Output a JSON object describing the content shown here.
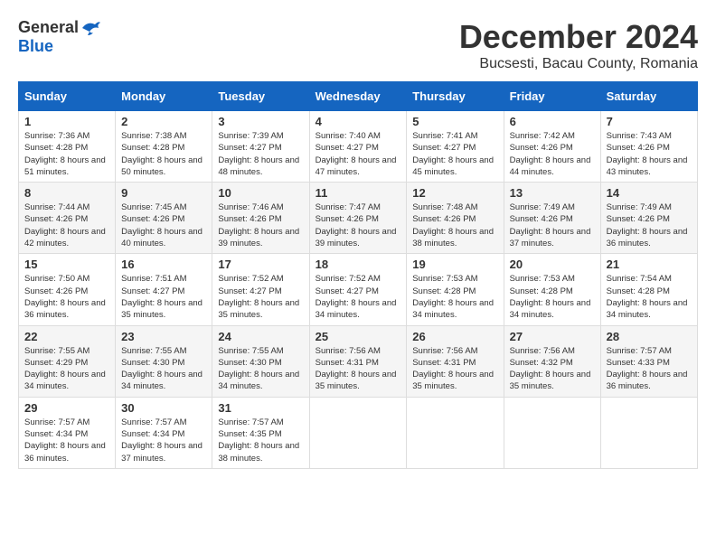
{
  "logo": {
    "general": "General",
    "blue": "Blue"
  },
  "title": {
    "month": "December 2024",
    "location": "Bucsesti, Bacau County, Romania"
  },
  "headers": [
    "Sunday",
    "Monday",
    "Tuesday",
    "Wednesday",
    "Thursday",
    "Friday",
    "Saturday"
  ],
  "weeks": [
    [
      {
        "day": "1",
        "sunrise": "7:36 AM",
        "sunset": "4:28 PM",
        "daylight": "8 hours and 51 minutes."
      },
      {
        "day": "2",
        "sunrise": "7:38 AM",
        "sunset": "4:28 PM",
        "daylight": "8 hours and 50 minutes."
      },
      {
        "day": "3",
        "sunrise": "7:39 AM",
        "sunset": "4:27 PM",
        "daylight": "8 hours and 48 minutes."
      },
      {
        "day": "4",
        "sunrise": "7:40 AM",
        "sunset": "4:27 PM",
        "daylight": "8 hours and 47 minutes."
      },
      {
        "day": "5",
        "sunrise": "7:41 AM",
        "sunset": "4:27 PM",
        "daylight": "8 hours and 45 minutes."
      },
      {
        "day": "6",
        "sunrise": "7:42 AM",
        "sunset": "4:26 PM",
        "daylight": "8 hours and 44 minutes."
      },
      {
        "day": "7",
        "sunrise": "7:43 AM",
        "sunset": "4:26 PM",
        "daylight": "8 hours and 43 minutes."
      }
    ],
    [
      {
        "day": "8",
        "sunrise": "7:44 AM",
        "sunset": "4:26 PM",
        "daylight": "8 hours and 42 minutes."
      },
      {
        "day": "9",
        "sunrise": "7:45 AM",
        "sunset": "4:26 PM",
        "daylight": "8 hours and 40 minutes."
      },
      {
        "day": "10",
        "sunrise": "7:46 AM",
        "sunset": "4:26 PM",
        "daylight": "8 hours and 39 minutes."
      },
      {
        "day": "11",
        "sunrise": "7:47 AM",
        "sunset": "4:26 PM",
        "daylight": "8 hours and 39 minutes."
      },
      {
        "day": "12",
        "sunrise": "7:48 AM",
        "sunset": "4:26 PM",
        "daylight": "8 hours and 38 minutes."
      },
      {
        "day": "13",
        "sunrise": "7:49 AM",
        "sunset": "4:26 PM",
        "daylight": "8 hours and 37 minutes."
      },
      {
        "day": "14",
        "sunrise": "7:49 AM",
        "sunset": "4:26 PM",
        "daylight": "8 hours and 36 minutes."
      }
    ],
    [
      {
        "day": "15",
        "sunrise": "7:50 AM",
        "sunset": "4:26 PM",
        "daylight": "8 hours and 36 minutes."
      },
      {
        "day": "16",
        "sunrise": "7:51 AM",
        "sunset": "4:27 PM",
        "daylight": "8 hours and 35 minutes."
      },
      {
        "day": "17",
        "sunrise": "7:52 AM",
        "sunset": "4:27 PM",
        "daylight": "8 hours and 35 minutes."
      },
      {
        "day": "18",
        "sunrise": "7:52 AM",
        "sunset": "4:27 PM",
        "daylight": "8 hours and 34 minutes."
      },
      {
        "day": "19",
        "sunrise": "7:53 AM",
        "sunset": "4:28 PM",
        "daylight": "8 hours and 34 minutes."
      },
      {
        "day": "20",
        "sunrise": "7:53 AM",
        "sunset": "4:28 PM",
        "daylight": "8 hours and 34 minutes."
      },
      {
        "day": "21",
        "sunrise": "7:54 AM",
        "sunset": "4:28 PM",
        "daylight": "8 hours and 34 minutes."
      }
    ],
    [
      {
        "day": "22",
        "sunrise": "7:55 AM",
        "sunset": "4:29 PM",
        "daylight": "8 hours and 34 minutes."
      },
      {
        "day": "23",
        "sunrise": "7:55 AM",
        "sunset": "4:30 PM",
        "daylight": "8 hours and 34 minutes."
      },
      {
        "day": "24",
        "sunrise": "7:55 AM",
        "sunset": "4:30 PM",
        "daylight": "8 hours and 34 minutes."
      },
      {
        "day": "25",
        "sunrise": "7:56 AM",
        "sunset": "4:31 PM",
        "daylight": "8 hours and 35 minutes."
      },
      {
        "day": "26",
        "sunrise": "7:56 AM",
        "sunset": "4:31 PM",
        "daylight": "8 hours and 35 minutes."
      },
      {
        "day": "27",
        "sunrise": "7:56 AM",
        "sunset": "4:32 PM",
        "daylight": "8 hours and 35 minutes."
      },
      {
        "day": "28",
        "sunrise": "7:57 AM",
        "sunset": "4:33 PM",
        "daylight": "8 hours and 36 minutes."
      }
    ],
    [
      {
        "day": "29",
        "sunrise": "7:57 AM",
        "sunset": "4:34 PM",
        "daylight": "8 hours and 36 minutes."
      },
      {
        "day": "30",
        "sunrise": "7:57 AM",
        "sunset": "4:34 PM",
        "daylight": "8 hours and 37 minutes."
      },
      {
        "day": "31",
        "sunrise": "7:57 AM",
        "sunset": "4:35 PM",
        "daylight": "8 hours and 38 minutes."
      },
      null,
      null,
      null,
      null
    ]
  ],
  "labels": {
    "sunrise": "Sunrise:",
    "sunset": "Sunset:",
    "daylight": "Daylight hours"
  }
}
